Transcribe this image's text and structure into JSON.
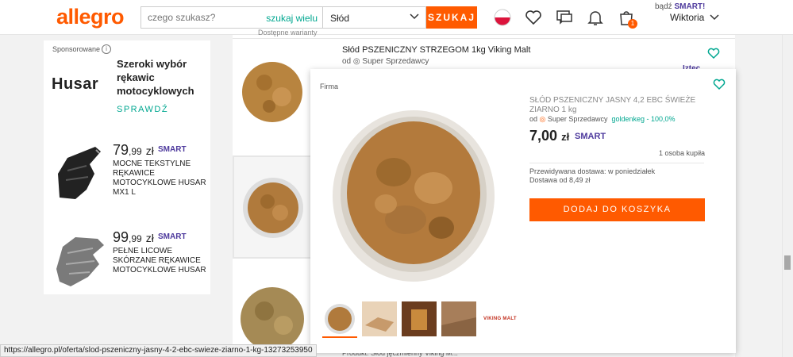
{
  "header": {
    "logo": "allegro",
    "search_placeholder": "czego szukasz?",
    "search_many": "szukaj wielu",
    "category": "Słód",
    "search_button": "SZUKAJ",
    "cart_count": "1",
    "smart_prefix": "bądź",
    "smart_label": "SMART!",
    "user": "Wiktoria"
  },
  "ad": {
    "sponsored": "Sponsorowane",
    "info_icon": "i",
    "logo": "Husar",
    "title": "Szeroki wybór rękawic motocyklowych",
    "cta": "SPRAWDŹ",
    "products": [
      {
        "price_int": "79",
        "price_dec": ",99",
        "currency": "zł",
        "smart": "SMART",
        "name": "MOCNE TEKSTYLNE RĘKAWICE MOTOCYKLOWE HUSAR MX1 L"
      },
      {
        "price_int": "99",
        "price_dec": ",99",
        "currency": "zł",
        "smart": "SMART",
        "name": "PEŁNE LICOWE SKÓRZANE RĘKAWICE MOTOCYKLOWE HUSAR"
      }
    ]
  },
  "listings": {
    "cut_text": "Dostępne warianty",
    "item1_title": "Słód PSZENICZNY STRZEGOM 1kg Viking Malt",
    "item1_seller_prefix": "od",
    "item1_seller": "Super Sprzedawcy",
    "brand_partial": "Iztec",
    "item3_product": "Produkt: Słód jęczmienny Viking M..."
  },
  "popup": {
    "firma": "Firma",
    "title": "SŁÓD PSZENICZNY JASNY 4,2 EBC ŚWIEŻE ZIARNO 1 kg",
    "seller_prefix": "od",
    "seller": "Super Sprzedawcy",
    "seller_rating": "goldenkeg - 100,0%",
    "price": "7,00",
    "currency": "zł",
    "smart": "SMART",
    "bought": "1 osoba kupiła",
    "delivery_line1": "Przewidywana dostawa: w poniedziałek",
    "delivery_line2": "Dostawa od 8,49 zł",
    "button": "DODAJ DO KOSZYKA",
    "thumb_brand": "VIKING MALT"
  },
  "status_url": "https://allegro.pl/oferta/slod-pszeniczny-jasny-4-2-ebc-swieze-ziarno-1-kg-13273253950",
  "colors": {
    "accent": "#ff5a00",
    "teal": "#00a790",
    "smart": "#4e3a9d"
  }
}
